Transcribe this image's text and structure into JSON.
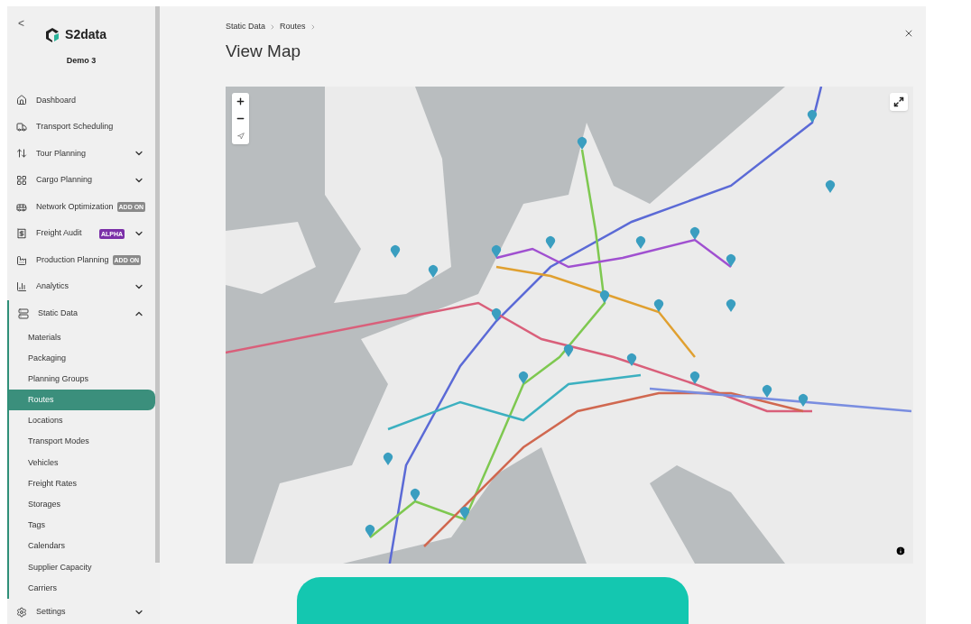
{
  "sidebar": {
    "back": "<",
    "brand": "S2data",
    "workspace": "Demo 3",
    "items": [
      {
        "label": "Dashboard"
      },
      {
        "label": "Transport Scheduling"
      },
      {
        "label": "Tour Planning",
        "expanded": false
      },
      {
        "label": "Cargo Planning",
        "expanded": false
      },
      {
        "label": "Network Optimization",
        "badge": {
          "text": "ADD ON",
          "kind": "addon"
        }
      },
      {
        "label": "Freight Audit",
        "badge": {
          "text": "ALPHA",
          "kind": "alpha"
        },
        "expanded": false
      },
      {
        "label": "Production Planning",
        "badge": {
          "text": "ADD ON",
          "kind": "addon"
        }
      },
      {
        "label": "Analytics",
        "expanded": false
      },
      {
        "label": "Static Data",
        "expanded": true,
        "children": [
          {
            "label": "Materials",
            "selected": false
          },
          {
            "label": "Packaging",
            "selected": false
          },
          {
            "label": "Planning Groups",
            "selected": false
          },
          {
            "label": "Routes",
            "selected": true
          },
          {
            "label": "Locations",
            "selected": false
          },
          {
            "label": "Transport Modes",
            "selected": false
          },
          {
            "label": "Vehicles",
            "selected": false
          },
          {
            "label": "Freight Rates",
            "selected": false
          },
          {
            "label": "Storages",
            "selected": false
          },
          {
            "label": "Tags",
            "selected": false
          },
          {
            "label": "Calendars",
            "selected": false
          },
          {
            "label": "Supplier Capacity",
            "selected": false
          },
          {
            "label": "Carriers",
            "selected": false
          }
        ]
      }
    ],
    "footer": {
      "label": "Settings",
      "expanded": false
    }
  },
  "breadcrumb": [
    "Static Data",
    "Routes"
  ],
  "title": "View Map"
}
